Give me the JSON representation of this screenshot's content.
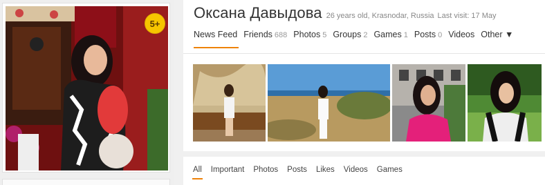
{
  "profile": {
    "name": "Оксана Давыдова",
    "age_location": "26 years old, Krasnodar, Russia",
    "last_visit": "Last visit: 17 May",
    "age_badge": "5+"
  },
  "nav": {
    "tabs": [
      {
        "label": "News Feed",
        "count": ""
      },
      {
        "label": "Friends",
        "count": "688"
      },
      {
        "label": "Photos",
        "count": "5"
      },
      {
        "label": "Groups",
        "count": "2"
      },
      {
        "label": "Games",
        "count": "1"
      },
      {
        "label": "Posts",
        "count": "0"
      },
      {
        "label": "Videos",
        "count": ""
      },
      {
        "label": "Other ▼",
        "count": ""
      }
    ],
    "active": "News Feed"
  },
  "feed_tabs": {
    "items": [
      "All",
      "Important",
      "Photos",
      "Posts",
      "Likes",
      "Videos",
      "Games"
    ],
    "active": "All"
  },
  "colors": {
    "accent": "#ee8208",
    "badge": "#f6c500"
  }
}
